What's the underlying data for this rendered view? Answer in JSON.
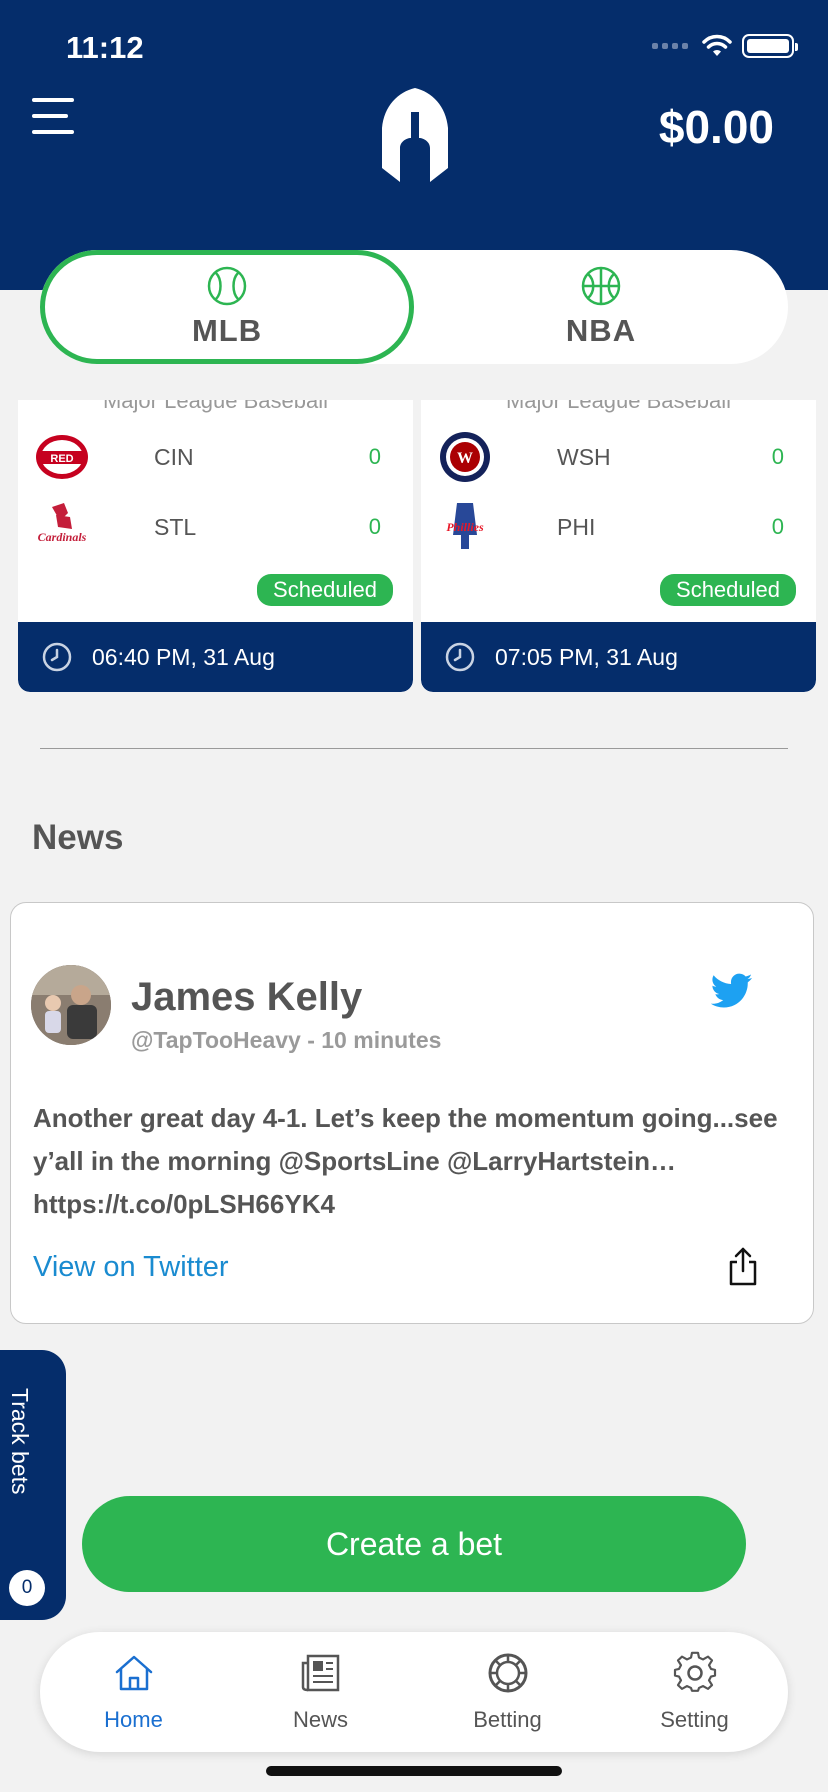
{
  "status_bar": {
    "time": "11:12"
  },
  "header": {
    "balance": "$0.00"
  },
  "sport_tabs": [
    {
      "label": "MLB",
      "active": true,
      "icon": "baseball-icon"
    },
    {
      "label": "NBA",
      "active": false,
      "icon": "basketball-icon"
    }
  ],
  "games": [
    {
      "league": "Major League Baseball",
      "home": {
        "abbr": "CIN",
        "score": "0",
        "logo": "reds-logo"
      },
      "away": {
        "abbr": "STL",
        "score": "0",
        "logo": "cardinals-logo"
      },
      "status": "Scheduled",
      "time": "06:40 PM, 31 Aug"
    },
    {
      "league": "Major League Baseball",
      "home": {
        "abbr": "WSH",
        "score": "0",
        "logo": "nationals-logo"
      },
      "away": {
        "abbr": "PHI",
        "score": "0",
        "logo": "phillies-logo"
      },
      "status": "Scheduled",
      "time": "07:05 PM, 31 Aug"
    }
  ],
  "news": {
    "title": "News",
    "card": {
      "author": "James Kelly",
      "handle": "@TapTooHeavy - 10 minutes",
      "text": "Another great day 4-1. Let’s keep the momentum going...see y’all in the morning @SportsLine @LarryHartstein… https://t.co/0pLSH66YK4",
      "link_label": "View on Twitter"
    }
  },
  "track_bets": {
    "label": "Track bets",
    "count": "0"
  },
  "create_bet": {
    "label": "Create a bet"
  },
  "bottom_nav": [
    {
      "label": "Home",
      "icon": "home-icon",
      "active": true
    },
    {
      "label": "News",
      "icon": "newspaper-icon",
      "active": false
    },
    {
      "label": "Betting",
      "icon": "chip-icon",
      "active": false
    },
    {
      "label": "Setting",
      "icon": "gear-icon",
      "active": false
    }
  ],
  "colors": {
    "navy": "#052d6b",
    "green": "#2db552",
    "link_blue": "#1a8bd0",
    "twitter_blue": "#1da1f2"
  }
}
